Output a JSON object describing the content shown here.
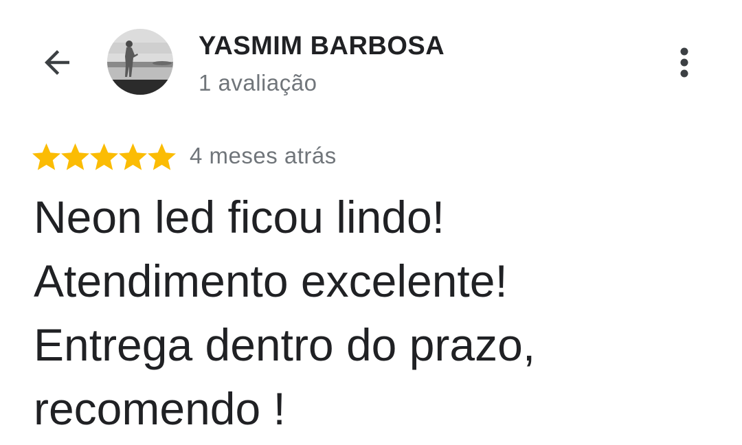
{
  "header": {
    "back_icon": "arrow-left-icon",
    "author_name": "YASMIM BARBOSA",
    "review_count": "1 avaliação",
    "more_icon": "more-vert-icon",
    "avatar_icon": "profile-photo"
  },
  "review": {
    "rating": 5,
    "rating_max": 5,
    "star_color": "#FBBC04",
    "date": "4 meses atrás",
    "lines": [
      "Neon led ficou lindo!",
      "Atendimento excelente!",
      "Entrega dentro do prazo,",
      "recomendo !"
    ]
  }
}
